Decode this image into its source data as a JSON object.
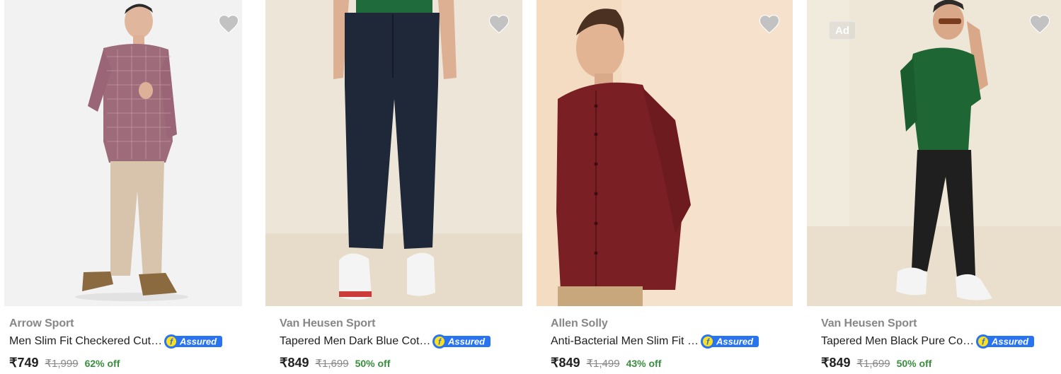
{
  "products": [
    {
      "brand": "Arrow Sport",
      "title": "Men Slim Fit Checkered Cut…",
      "assured_badge": "Assured",
      "price": "₹749",
      "mrp": "₹1,999",
      "discount": "62% off",
      "wishlist_icon": "heart-icon"
    },
    {
      "brand": "Van Heusen Sport",
      "title": "Tapered Men Dark Blue Cot…",
      "assured_badge": "Assured",
      "price": "₹849",
      "mrp": "₹1,699",
      "discount": "50% off",
      "wishlist_icon": "heart-icon"
    },
    {
      "brand": "Allen Solly",
      "title": "Anti-Bacterial Men Slim Fit …",
      "assured_badge": "Assured",
      "price": "₹849",
      "mrp": "₹1,499",
      "discount": "43% off",
      "wishlist_icon": "heart-icon"
    },
    {
      "brand": "Van Heusen Sport",
      "title": "Tapered Men Black Pure Co…",
      "assured_badge": "Assured",
      "ad_label": "Ad",
      "price": "₹849",
      "mrp": "₹1,699",
      "discount": "50% off",
      "wishlist_icon": "heart-icon"
    }
  ],
  "colors": {
    "discount_green": "#388e3c",
    "assured_blue": "#2874f0",
    "assured_yellow": "#ffe11b",
    "brand_grey": "#878787"
  }
}
